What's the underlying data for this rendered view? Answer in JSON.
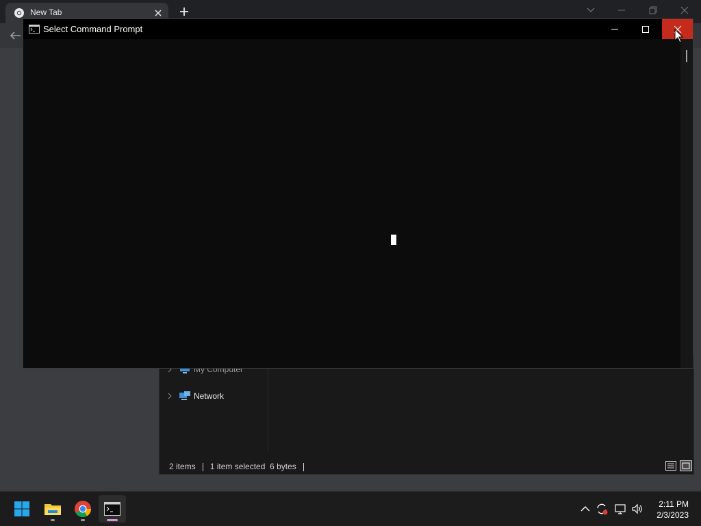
{
  "chrome": {
    "tab_title": "New Tab"
  },
  "cmd": {
    "title": "Select Command Prompt"
  },
  "explorer": {
    "tree": [
      {
        "label": "My Computer"
      },
      {
        "label": "Network"
      }
    ],
    "status": {
      "items": "2 items",
      "selected": "1 item selected",
      "size": "6 bytes"
    }
  },
  "taskbar": {
    "apps": [
      "start-icon",
      "file-explorer-icon",
      "chrome-icon",
      "command-prompt-icon"
    ],
    "time": "2:11 PM",
    "date": "2/3/2023"
  },
  "colors": {
    "close_hover": "#c42b1c",
    "console_bg": "#0c0c0c",
    "active_indicator": "#d597d9"
  }
}
